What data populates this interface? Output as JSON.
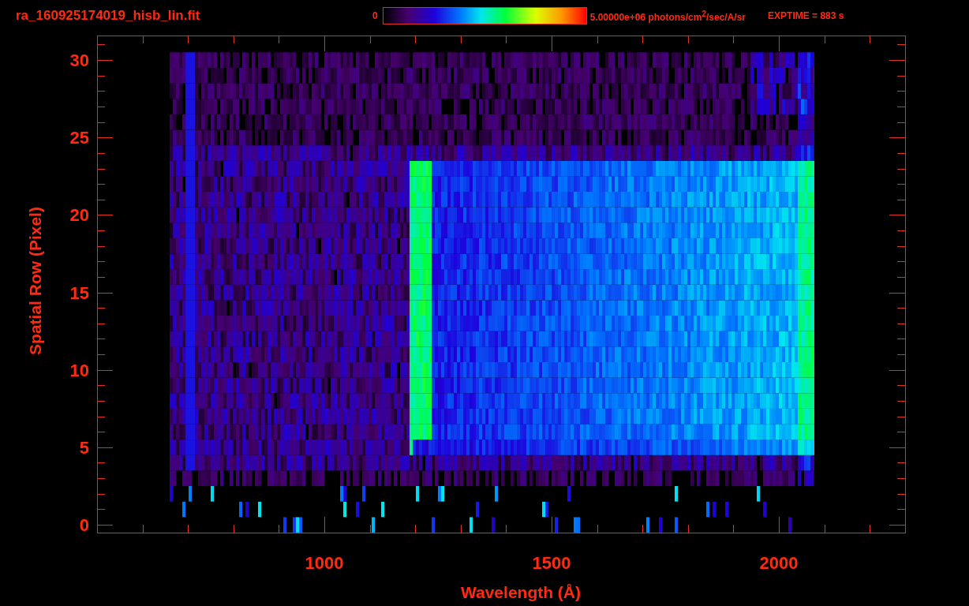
{
  "header": {
    "title": "ra_160925174019_hisb_lin.fit",
    "colorbar": {
      "min_label": "0",
      "max_label": "5.00000e+06 photons/cm$^{2}$/sec/A/sr"
    },
    "exposure": "EXPTIME = 883 s"
  },
  "plot": {
    "xlabel": "Wavelength (Å)",
    "ylabel": "Spatial Row (Pixel)",
    "xticks": [
      "1000",
      "1500",
      "2000"
    ],
    "yticks": [
      "30",
      "25",
      "20",
      "15",
      "10",
      "5",
      "0"
    ]
  }
}
